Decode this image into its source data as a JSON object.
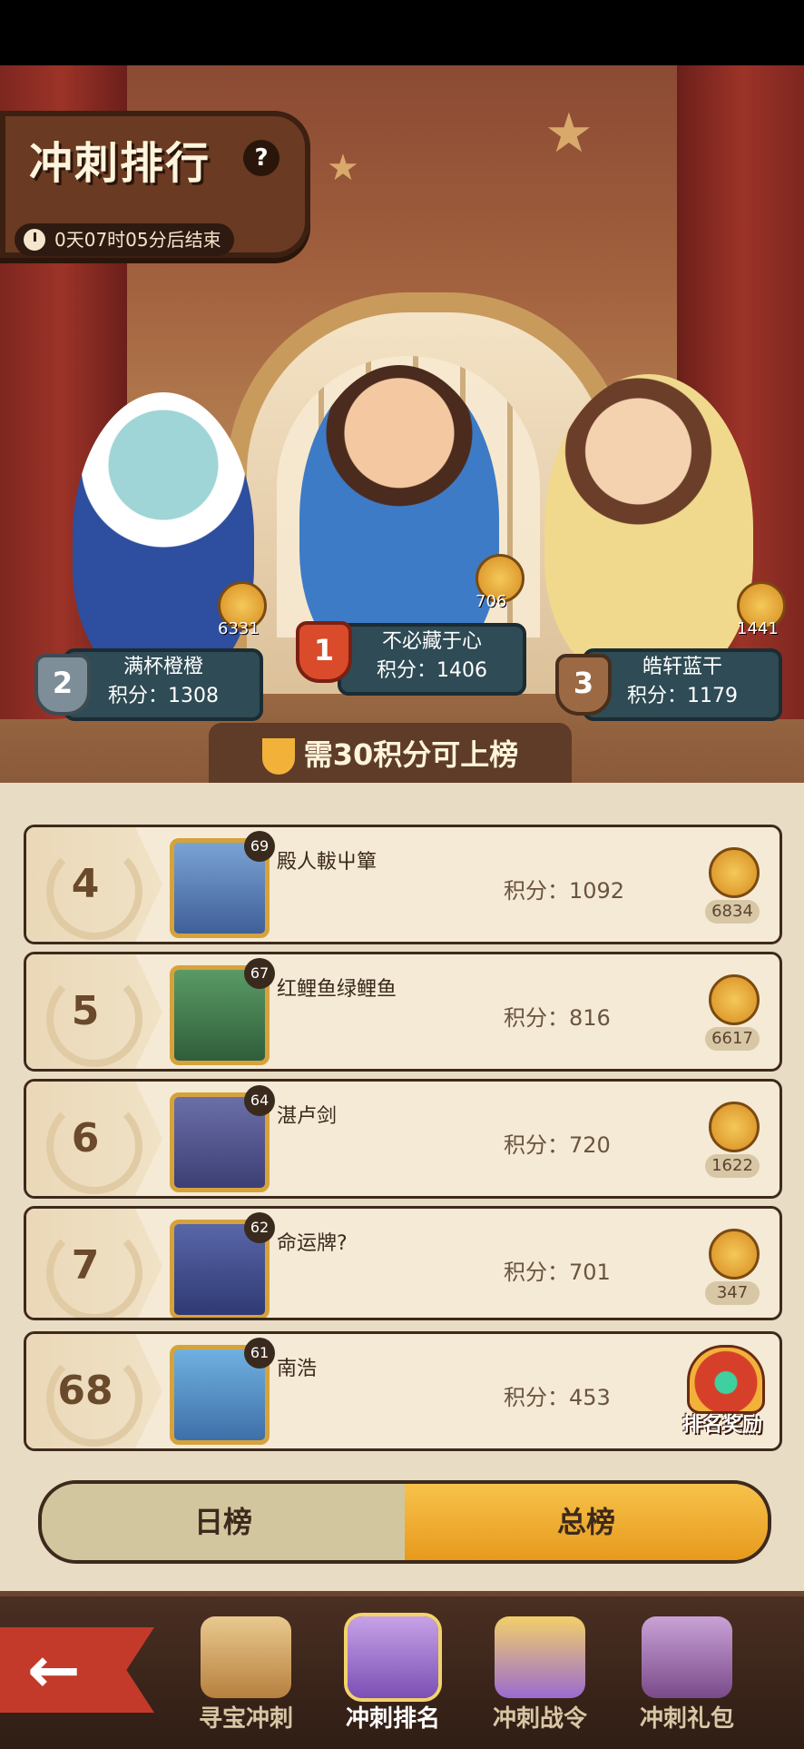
{
  "header": {
    "title": "冲刺排行",
    "help": "?",
    "timer": "0天07时05分后结束"
  },
  "podium": [
    {
      "rank": "2",
      "name": "满杯橙橙",
      "score": "积分：1308",
      "likes": "6331"
    },
    {
      "rank": "1",
      "name": "不必藏于心",
      "score": "积分：1406",
      "likes": "706"
    },
    {
      "rank": "3",
      "name": "皓轩蓝干",
      "score": "积分：1179",
      "likes": "1441"
    }
  ],
  "need_banner": "需30积分可上榜",
  "rows": [
    {
      "rank": "4",
      "level": "69",
      "name": "殿人軷屮簞",
      "score": "积分：1092",
      "likes": "6834"
    },
    {
      "rank": "5",
      "level": "67",
      "name": "红鲤鱼绿鲤鱼",
      "score": "积分：816",
      "likes": "6617"
    },
    {
      "rank": "6",
      "level": "64",
      "name": "湛卢剑",
      "score": "积分：720",
      "likes": "1622"
    },
    {
      "rank": "7",
      "level": "62",
      "name": "命运牌?",
      "score": "积分：701",
      "likes": "347"
    }
  ],
  "me": {
    "rank": "68",
    "level": "61",
    "name": "南浩",
    "score": "积分：453",
    "reward_label": "排名奖励"
  },
  "tabs": {
    "daily": "日榜",
    "total": "总榜"
  },
  "nav": {
    "items": [
      "寻宝冲刺",
      "冲刺排名",
      "冲刺战令",
      "冲刺礼包"
    ],
    "active": "冲刺排名"
  },
  "colors": {
    "accent": "#e79a1c",
    "panel": "#e9dcc4",
    "navbar": "#2f1d14"
  }
}
